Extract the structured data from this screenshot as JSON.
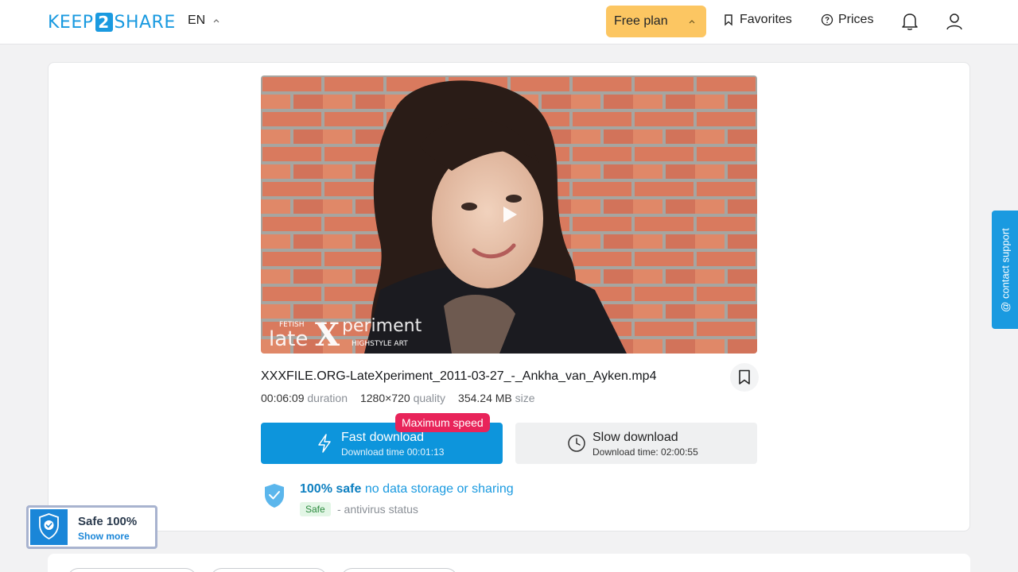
{
  "header": {
    "logo": {
      "left": "KEEP",
      "mid": "2",
      "right": "SHARE"
    },
    "lang": "EN",
    "plan": "Free plan",
    "favorites": "Favorites",
    "prices": "Prices"
  },
  "file": {
    "name": "XXXFILE.ORG-LateXperiment_2011-03-27_-_Ankha_van_Ayken.mp4",
    "duration": "00:06:09",
    "duration_label": "duration",
    "quality": "1280×720",
    "quality_label": "quality",
    "size": "354.24 MB",
    "size_label": "size"
  },
  "preview": {
    "watermark_small": "FETISH",
    "watermark_main": "late",
    "watermark_x": "X",
    "watermark_rest": "periment",
    "watermark_tag": "HIGHSTYLE ART"
  },
  "download": {
    "badge": "Maximum speed",
    "fast_title": "Fast download",
    "fast_sub": "Download time 00:01:13",
    "slow_title": "Slow download",
    "slow_sub": "Download time: 02:00:55"
  },
  "safety": {
    "strong": "100% safe",
    "rest": "no data storage or sharing",
    "tag": "Safe",
    "status": "- antivirus status"
  },
  "contact": "@ contact support",
  "widget": {
    "title": "Safe 100%",
    "more": "Show more"
  },
  "colors": {
    "accent": "#1a9ae0",
    "plan": "#fcc662",
    "badge": "#e8245a"
  }
}
